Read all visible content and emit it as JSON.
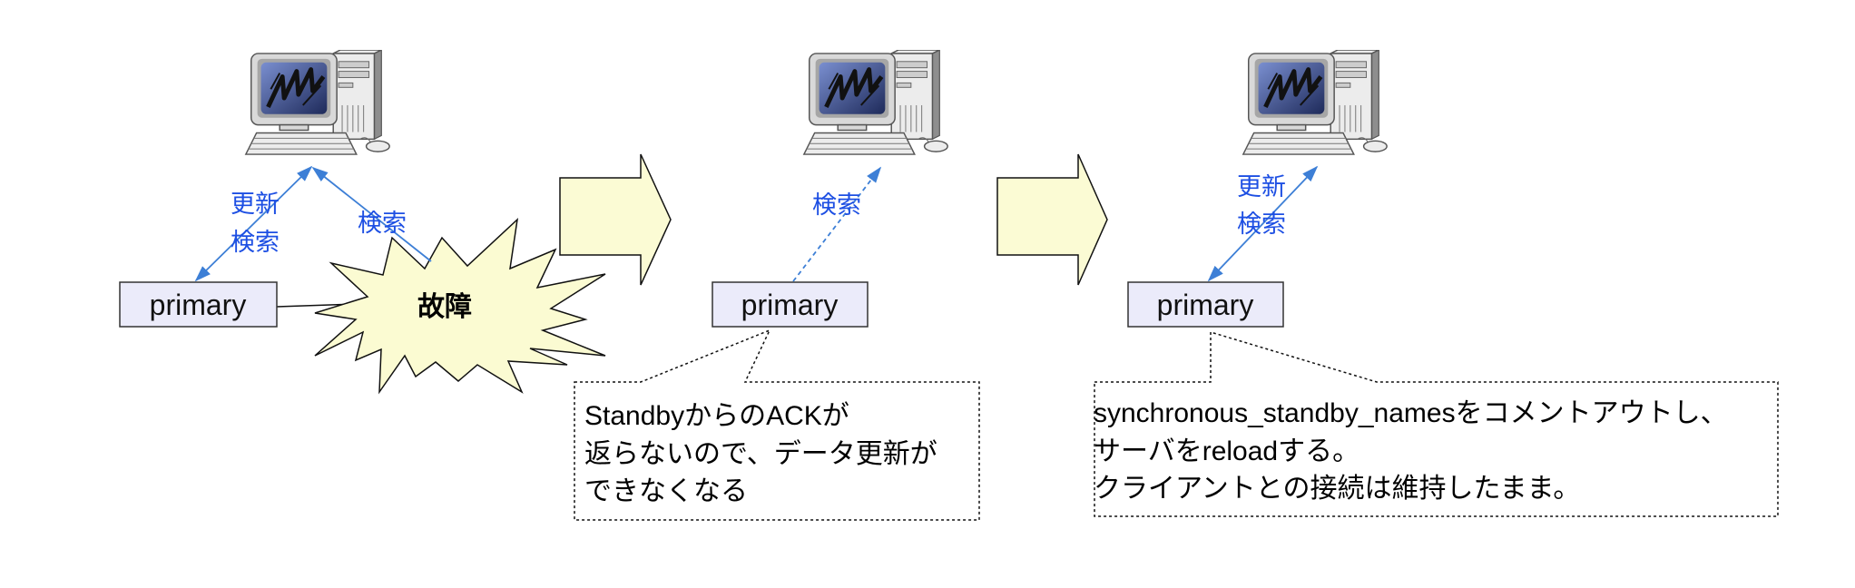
{
  "panels": {
    "failure": {
      "server_label": "primary",
      "client_arrow_labels": [
        "更新",
        "検索"
      ],
      "burst_arrow_label": "検索",
      "burst_label": "故障"
    },
    "blocked": {
      "server_label": "primary",
      "arrow_label": "検索",
      "callout_lines": [
        "StandbyからのACKが",
        "返らないので、データ更新が",
        "できなくなる"
      ]
    },
    "recovered": {
      "server_label": "primary",
      "arrow_labels": [
        "更新",
        "検索"
      ],
      "callout_lines": [
        "synchronous_standby_namesをコメントアウトし、",
        "サーバをreloadする。",
        "クライアントとの接続は維持したまま。"
      ]
    }
  },
  "colors": {
    "arrow": "#3d7fd6",
    "arrow_label": "#1d4fe3",
    "server_box_fill": "#ebebfa",
    "burst_fill": "#fbfbd2",
    "transition_arrow_fill": "#fbfbd4",
    "screen_light": "#7a8fd0",
    "screen_dark": "#1e2a5a"
  }
}
